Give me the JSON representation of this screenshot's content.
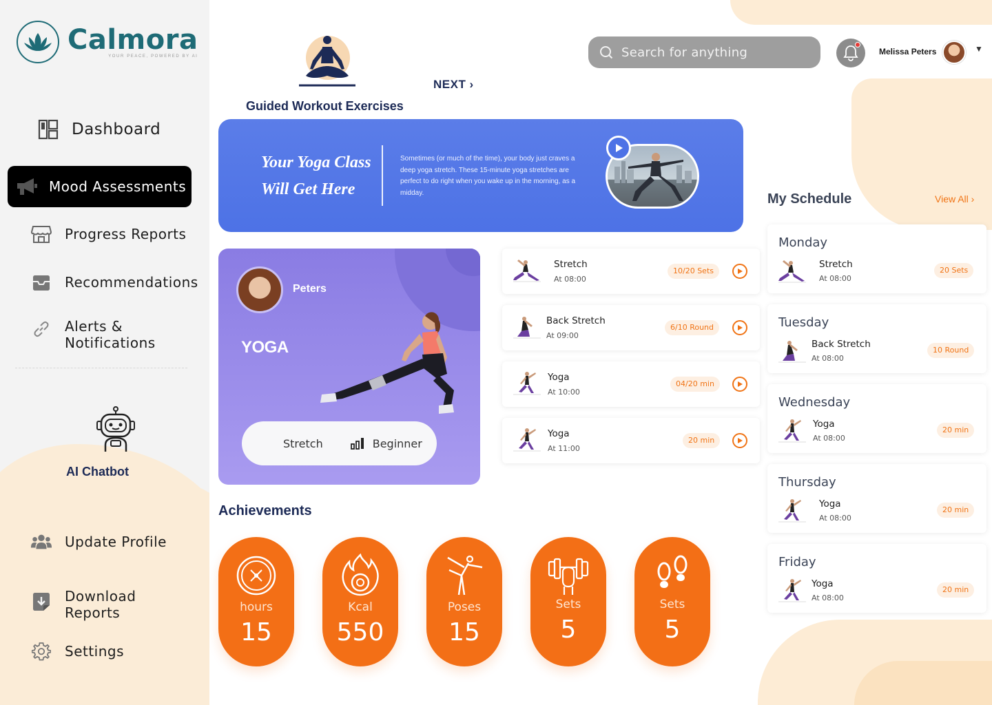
{
  "brand": {
    "name": "Calmora",
    "tagline": "YOUR PEACE, POWERED BY AI"
  },
  "sidebar": {
    "items": [
      {
        "label": "Dashboard",
        "icon": "dashboard-icon"
      },
      {
        "label": "Mood Assessments",
        "icon": "megaphone-icon",
        "active": true
      },
      {
        "label": "Progress Reports",
        "icon": "store-icon"
      },
      {
        "label": "Recommendations",
        "icon": "inbox-icon"
      },
      {
        "label_line1": "Alerts &",
        "label_line2": "Notifications",
        "icon": "link-icon"
      }
    ],
    "chatbot_label": "AI Chatbot",
    "bottom_items": [
      {
        "label": "Update Profile",
        "icon": "users-icon"
      },
      {
        "label_line1": "Download",
        "label_line2": "Reports",
        "icon": "download-icon"
      },
      {
        "label": "Settings",
        "icon": "gear-icon"
      }
    ]
  },
  "header": {
    "search_placeholder": "Search for anything",
    "user_name": "Melissa Peters"
  },
  "guided": {
    "title": "Guided Workout Exercises",
    "next_label": "NEXT ›"
  },
  "banner": {
    "heading_line1": "Your Yoga Class",
    "heading_line2": "Will Get Here",
    "text": "Sometimes (or much of the time), your body just craves a deep yoga stretch. These 15-minute yoga stretches are perfect to do right when you wake up in the morning, as a midday."
  },
  "yoga_card": {
    "user": "Peters",
    "title": "YOGA",
    "tag": "Stretch",
    "level": "Beginner"
  },
  "exercises": [
    {
      "name": "Stretch",
      "time": "At 08:00",
      "badge": "10/20 Sets"
    },
    {
      "name": "Back Stretch",
      "time": "At 09:00",
      "badge": "6/10 Round"
    },
    {
      "name": "Yoga",
      "time": "At 10:00",
      "badge": "04/20 min"
    },
    {
      "name": "Yoga",
      "time": "At 11:00",
      "badge": "20 min"
    }
  ],
  "achievements": {
    "title": "Achievements",
    "items": [
      {
        "label": "hours",
        "value": "15",
        "icon": "clock-icon"
      },
      {
        "label": "Kcal",
        "value": "550",
        "icon": "flame-icon"
      },
      {
        "label": "Poses",
        "value": "15",
        "icon": "yoga-pose-icon"
      },
      {
        "label": "Sets",
        "value": "5",
        "icon": "dumbbell-icon"
      },
      {
        "label": "Sets",
        "value": "5",
        "icon": "footsteps-icon"
      }
    ]
  },
  "schedule": {
    "title": "My Schedule",
    "view_all": "View All  ›",
    "days": [
      {
        "day": "Monday",
        "name": "Stretch",
        "time": "At 08:00",
        "badge": "20 Sets"
      },
      {
        "day": "Tuesday",
        "name": "Back Stretch",
        "time": "At 08:00",
        "badge": "10 Round"
      },
      {
        "day": "Wednesday",
        "name": "Yoga",
        "time": "At 08:00",
        "badge": "20 min"
      },
      {
        "day": "Thursday",
        "name": "Yoga",
        "time": "At 08:00",
        "badge": "20 min"
      },
      {
        "day": "Friday",
        "name": "Yoga",
        "time": "At 08:00",
        "badge": "20 min"
      }
    ]
  },
  "colors": {
    "accent": "#f36f16",
    "brand": "#1e6b76",
    "banner": "#4d72e6",
    "card": "#8a7ce3",
    "navy": "#1c2a56"
  }
}
